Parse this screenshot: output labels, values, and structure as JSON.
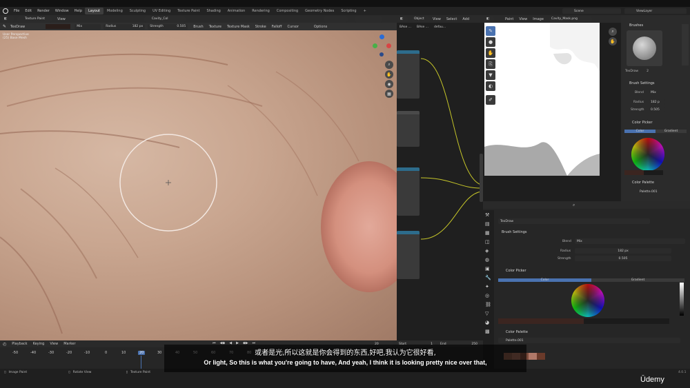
{
  "menu": {
    "items": [
      "File",
      "Edit",
      "Render",
      "Window",
      "Help"
    ],
    "workspaces": [
      "Layout",
      "Modeling",
      "Sculpting",
      "UV Editing",
      "Texture Paint",
      "Shading",
      "Animation",
      "Rendering",
      "Compositing",
      "Geometry Nodes",
      "Scripting"
    ],
    "active_workspace": "Layout",
    "add_tab": "+",
    "scene_label": "Scene",
    "view_layer_label": "ViewLayer"
  },
  "viewport_header": {
    "mode": "Texture Paint",
    "view": "View",
    "image_name": "Cavity_Col"
  },
  "node_header": {
    "editor": "Object",
    "view": "View",
    "select": "Select",
    "add": "Add",
    "breadcrumbs": [
      "BAse ...",
      "BAse ...",
      "defau..."
    ]
  },
  "image_header": {
    "paint": "Paint",
    "view": "View",
    "image": "Image",
    "image_name": "Cavity_Mask.png"
  },
  "tool_settings": {
    "brush": "TexDraw",
    "blend_mode": "Mix",
    "radius_label": "Radius",
    "radius_value": "182 px",
    "strength_label": "Strength",
    "strength_value": "0.505",
    "brush_menu": "Brush",
    "texture_menu": "Texture",
    "texture_mask_menu": "Texture Mask",
    "stroke_menu": "Stroke",
    "falloff_menu": "Falloff",
    "cursor_menu": "Cursor",
    "options_menu": "Options"
  },
  "viewport_overlay": {
    "line1": "User Perspective",
    "line2": "(25) Base Mesh"
  },
  "brushes_panel": {
    "title": "Brushes",
    "brush_name": "TexDraw",
    "brush_count": "2",
    "brush_settings": "Brush Settings",
    "blend_label": "Blend",
    "blend_value": "Mix",
    "radius_label": "Radius",
    "radius_value": "182 p",
    "strength_label": "Strength",
    "strength_value": "0.505",
    "color_picker": "Color Picker",
    "color_tab": "Color",
    "gradient_tab": "Gradient",
    "color_palette": "Color Palette",
    "palette_name": "Palette.001",
    "wheel_colors": {
      "fg": "#3b2520",
      "bg": "#1b1b1b"
    }
  },
  "properties": {
    "brush_name": "TexDraw",
    "brush_settings": "Brush Settings",
    "blend_label": "Blend",
    "blend_value": "Mix",
    "radius_label": "Radius",
    "radius_value": "182 px",
    "strength_label": "Strength",
    "strength_value": "0.505",
    "color_picker": "Color Picker",
    "color_tab": "Color",
    "gradient_tab": "Gradient",
    "color_palette": "Color Palette",
    "palette_name": "Palette.001"
  },
  "timeline": {
    "playback": "Playback",
    "keying": "Keying",
    "view": "View",
    "marker": "Marker",
    "ticks": [
      "-50",
      "-40",
      "-30",
      "-20",
      "-10",
      "0",
      "10",
      "20",
      "30",
      "40",
      "50",
      "60",
      "70",
      "80",
      "90",
      "100",
      "110"
    ],
    "current_frame": "20",
    "start_label": "Start",
    "start_value": "1",
    "end_label": "End",
    "end_value": "250"
  },
  "statusbar": {
    "item1": "Image Paint",
    "item2": "Rotate View",
    "item3": "Texture Paint",
    "version": "4.0.1"
  },
  "subtitles": {
    "cn": "或者是光,所以这就是你会得到的东西,好吧,我认为它很好看,",
    "en": "Or light, So this is what you're going to have, And yeah, I think it is looking pretty nice over that,"
  },
  "watermark": "Ūdemy"
}
